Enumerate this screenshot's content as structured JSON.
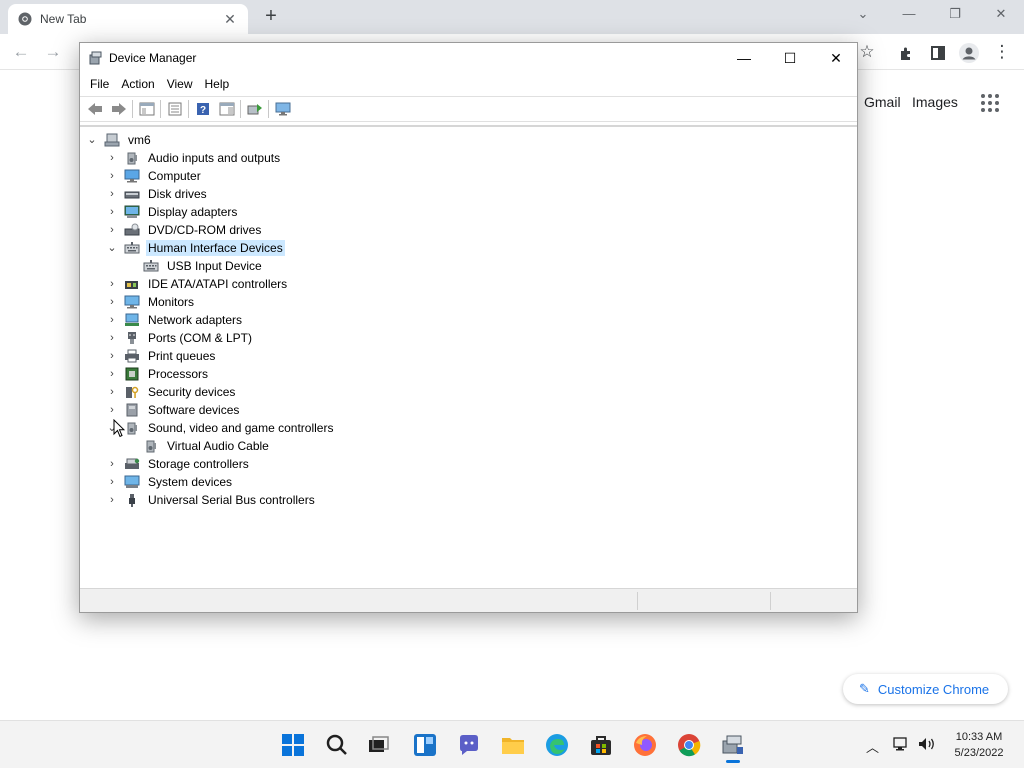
{
  "browser": {
    "tab_title": "New Tab",
    "ntp_links": [
      "Gmail",
      "Images"
    ],
    "customize_label": "Customize Chrome"
  },
  "device_manager": {
    "title": "Device Manager",
    "menu": [
      "File",
      "Action",
      "View",
      "Help"
    ],
    "root": "vm6",
    "nodes": [
      {
        "label": "Audio inputs and outputs",
        "icon": "speaker-icon",
        "expanded": false
      },
      {
        "label": "Computer",
        "icon": "computer-icon",
        "expanded": false
      },
      {
        "label": "Disk drives",
        "icon": "disk-drive-icon",
        "expanded": false
      },
      {
        "label": "Display adapters",
        "icon": "display-adapter-icon",
        "expanded": false
      },
      {
        "label": "DVD/CD-ROM drives",
        "icon": "dvd-drive-icon",
        "expanded": false
      },
      {
        "label": "Human Interface Devices",
        "icon": "hid-icon",
        "expanded": true,
        "selected": true
      },
      {
        "label": "USB Input Device",
        "icon": "hid-icon",
        "child": true
      },
      {
        "label": "IDE ATA/ATAPI controllers",
        "icon": "ide-controller-icon",
        "expanded": false
      },
      {
        "label": "Monitors",
        "icon": "monitor-icon",
        "expanded": false
      },
      {
        "label": "Network adapters",
        "icon": "network-adapter-icon",
        "expanded": false
      },
      {
        "label": "Ports (COM & LPT)",
        "icon": "port-icon",
        "expanded": false
      },
      {
        "label": "Print queues",
        "icon": "printer-icon",
        "expanded": false
      },
      {
        "label": "Processors",
        "icon": "processor-icon",
        "expanded": false
      },
      {
        "label": "Security devices",
        "icon": "security-device-icon",
        "expanded": false
      },
      {
        "label": "Software devices",
        "icon": "software-device-icon",
        "expanded": false
      },
      {
        "label": "Sound, video and game controllers",
        "icon": "speaker-icon",
        "expanded": true
      },
      {
        "label": "Virtual Audio Cable",
        "icon": "speaker-icon",
        "child": true
      },
      {
        "label": "Storage controllers",
        "icon": "storage-controller-icon",
        "expanded": false
      },
      {
        "label": "System devices",
        "icon": "system-device-icon",
        "expanded": false
      },
      {
        "label": "Universal Serial Bus controllers",
        "icon": "usb-icon",
        "expanded": false
      }
    ]
  },
  "taskbar": {
    "time": "10:33 AM",
    "date": "5/23/2022",
    "apps": [
      "start-icon",
      "search-icon",
      "task-view-icon",
      "widgets-icon",
      "chat-icon",
      "file-explorer-icon",
      "edge-icon",
      "store-icon",
      "firefox-icon",
      "chrome-icon",
      "device-manager-icon"
    ]
  },
  "colors": {
    "selection": "#cce8ff",
    "chrome_tabbar": "#dee1e6",
    "taskbar": "#f3f3f3",
    "accent_blue": "#1a73e8"
  }
}
